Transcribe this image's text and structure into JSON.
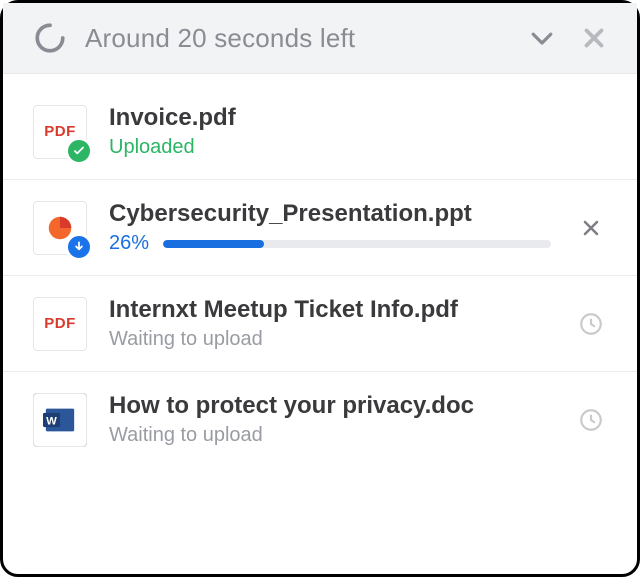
{
  "header": {
    "title": "Around 20 seconds left"
  },
  "files": [
    {
      "name": "Invoice.pdf",
      "status_text": "Uploaded",
      "status": "done",
      "type": "pdf",
      "type_label": "PDF"
    },
    {
      "name": "Cybersecurity_Presentation.ppt",
      "status_text": "26%",
      "status": "progress",
      "progress": 26,
      "type": "ppt"
    },
    {
      "name": "Internxt Meetup Ticket Info.pdf",
      "status_text": "Waiting to upload",
      "status": "waiting",
      "type": "pdf",
      "type_label": "PDF"
    },
    {
      "name": "How to protect your privacy.doc",
      "status_text": "Waiting to upload",
      "status": "waiting",
      "type": "doc"
    }
  ],
  "colors": {
    "accent": "#1a6fe0",
    "success": "#2bb564",
    "muted": "#9a9ca3"
  }
}
